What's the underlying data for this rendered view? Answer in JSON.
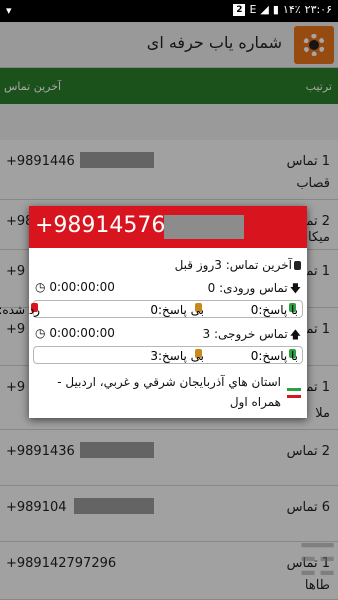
{
  "statusbar": {
    "time": "۲۳:۰۶",
    "battery": "۱۴٪",
    "left_icon": "wifi-icon",
    "right_badges": [
      "E",
      "2"
    ]
  },
  "app": {
    "title": "شماره یاب حرفه ای",
    "icon": "gear-search-icon",
    "accent": "#e6731b"
  },
  "header": {
    "last_call_col": "آخرین تماس",
    "order_col": "ترتیب",
    "color": "#2a7d2a"
  },
  "rows": [
    {
      "number": "+9891446",
      "calls": "1 تماس",
      "name": "قصاب"
    },
    {
      "number": "+98",
      "calls": "2 تماس",
      "name": "میکا"
    },
    {
      "number": "+9",
      "calls": "1 تماس",
      "name": ""
    },
    {
      "number": "+9",
      "calls": "1 تماس",
      "name": ""
    },
    {
      "number": "+9",
      "calls": "1 تماس",
      "name": "ملا"
    },
    {
      "number": "+9891436",
      "calls": "2 تماس",
      "name": ""
    },
    {
      "number": "+989104",
      "calls": "6 تماس",
      "name": ""
    },
    {
      "number": "+989142797296",
      "calls": "1 تماس",
      "name": "طاها"
    }
  ],
  "popup": {
    "number": "+98914576",
    "header_color": "#d8141e",
    "last_call": "آخرین تماس: 3روز قبل",
    "incoming": "تماس ورودی: 0",
    "incoming_time": "0:00:00:00",
    "in_answered": "با پاسخ:0",
    "in_unanswered": "بی پاسخ:0",
    "in_rejected": "رد شده:0",
    "outgoing": "تماس خروجی: 3",
    "outgoing_time": "0:00:00:00",
    "out_answered": "با پاسخ:0",
    "out_unanswered": "بی پاسخ:3",
    "region": "استان هاي آذربايجان شرقي و غربي، اردبيل - همراه اول"
  }
}
